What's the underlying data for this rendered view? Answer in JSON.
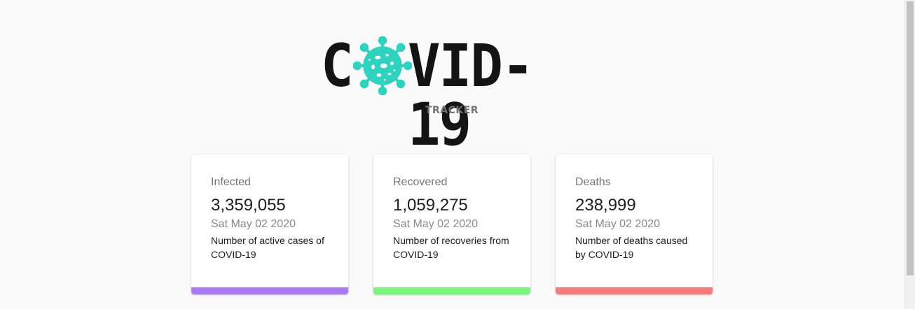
{
  "logo": {
    "first_letter": "C",
    "rest": "VID-19",
    "tagline": "TRACKER",
    "virus_color": "#2ed3c0"
  },
  "cards": [
    {
      "label": "Infected",
      "value": "3,359,055",
      "date": "Sat May 02 2020",
      "description": "Number of active cases of COVID-19",
      "accent_color": "#a97cf5"
    },
    {
      "label": "Recovered",
      "value": "1,059,275",
      "date": "Sat May 02 2020",
      "description": "Number of recoveries from COVID-19",
      "accent_color": "#7bf57b"
    },
    {
      "label": "Deaths",
      "value": "238,999",
      "date": "Sat May 02 2020",
      "description": "Number of deaths caused by COVID-19",
      "accent_color": "#f57b7b"
    }
  ]
}
